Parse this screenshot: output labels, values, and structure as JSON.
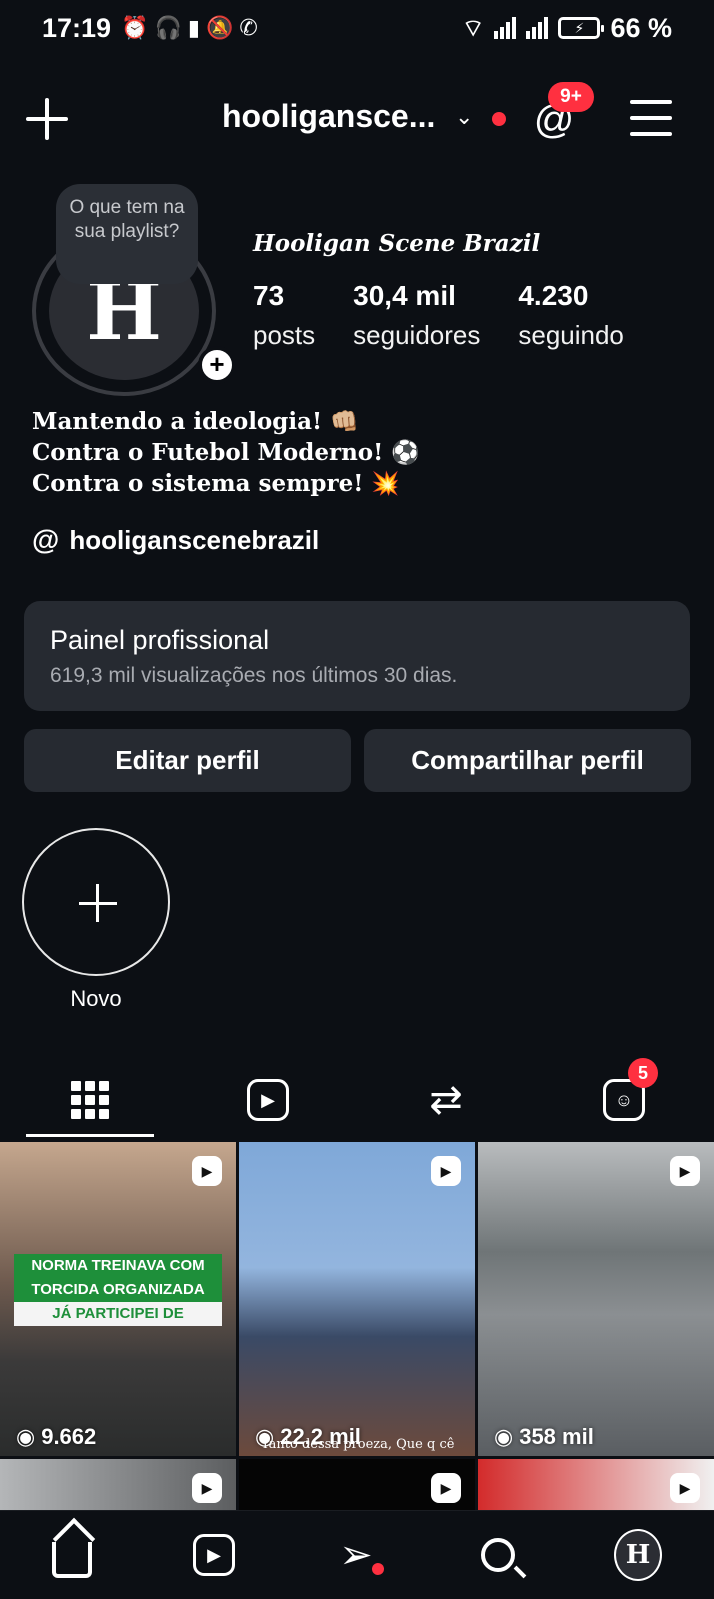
{
  "status_bar": {
    "time": "17:19",
    "left_icons": [
      "alarm-icon",
      "headphones-icon",
      "battery-saver-icon",
      "mute-icon",
      "whatsapp-icon"
    ],
    "battery_percent": "66 %",
    "battery_level": 0.66
  },
  "header": {
    "username": "hooligansce...",
    "threads_badge": "9+",
    "accent_color": "#ff3040"
  },
  "profile": {
    "note_text": "O que tem na sua playlist?",
    "display_name": "Hooligan Scene Brazil",
    "avatar_glyph": "H",
    "stats": [
      {
        "value": "73",
        "label": "posts"
      },
      {
        "value": "30,4 mil",
        "label": "seguidores"
      },
      {
        "value": "4.230",
        "label": "seguindo"
      }
    ],
    "bio_lines": [
      "Mantendo a ideologia! 👊🏼",
      "Contra o Futebol Moderno! ⚽",
      "Contra o sistema sempre! 💥"
    ],
    "threads_link": "hooliganscenebrazil"
  },
  "dashboard": {
    "title": "Painel profissional",
    "subtitle": "619,3 mil visualizações nos últimos 30 dias."
  },
  "buttons": {
    "edit": "Editar perfil",
    "share": "Compartilhar perfil"
  },
  "highlights": {
    "new_label": "Novo"
  },
  "tabs": {
    "items": [
      "grid-icon",
      "reels-icon",
      "reposts-icon",
      "tagged-icon"
    ],
    "tagged_badge": "5"
  },
  "posts": [
    {
      "views": "9.662",
      "caption_green_1": "NORMA TREINAVA COM",
      "caption_green_2": "TORCIDA ORGANIZADA",
      "caption_white": "JÁ PARTICIPEI DE"
    },
    {
      "views": "22,2 mil",
      "subtitle": "Tanto dessa proeza, Que q cê"
    },
    {
      "views": "358 mil"
    }
  ]
}
